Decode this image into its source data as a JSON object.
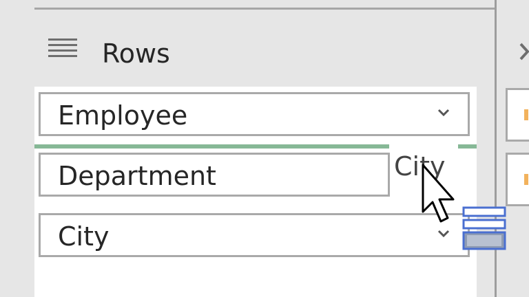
{
  "panel": {
    "title": "Rows",
    "icon": "rows-list-icon"
  },
  "fields": [
    {
      "label": "Employee",
      "has_dropdown": true
    },
    {
      "label": "Department",
      "has_dropdown": false
    },
    {
      "label": "City",
      "has_dropdown": true
    }
  ],
  "drag": {
    "ghost_label": "City",
    "cursor_icon": "arrow-cursor-icon",
    "drag_icon": "field-drag-icon"
  },
  "colors": {
    "drop_indicator": "#86b896",
    "border": "#a9a9a9",
    "panel_bg": "#e6e6e6",
    "list_bg": "#ffffff",
    "accent_icon": "#4a6fd0",
    "right_mark": "#f2b25c"
  }
}
